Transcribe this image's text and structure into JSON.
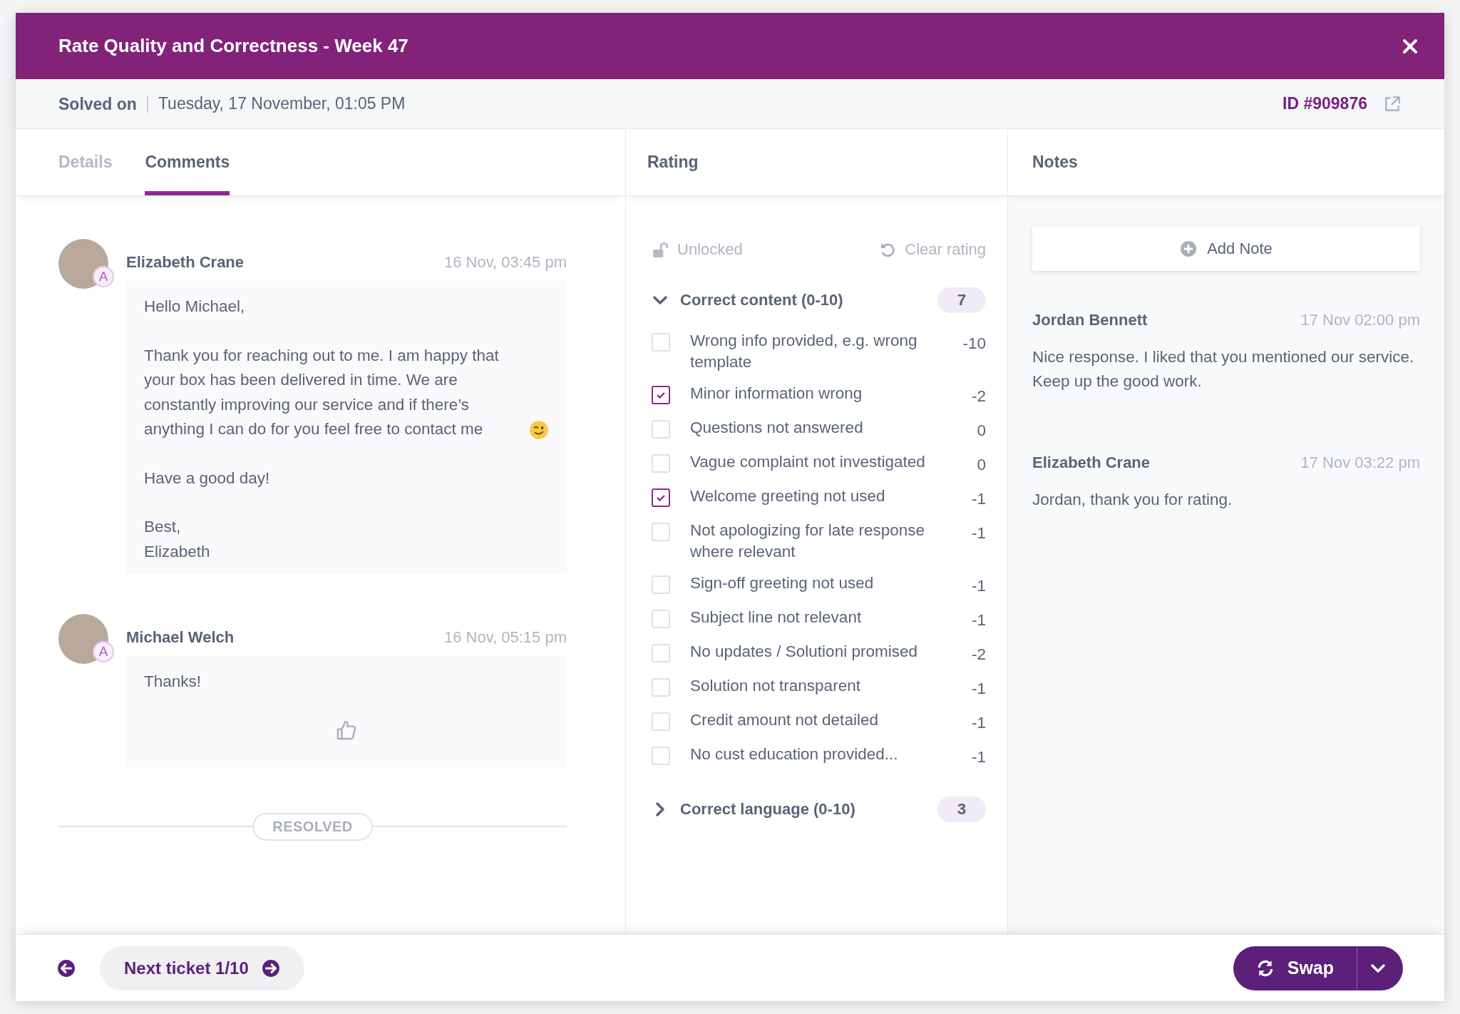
{
  "window": {
    "title": "Rate Quality and Correctness - Week 47"
  },
  "solved": {
    "label": "Solved on",
    "date": "Tuesday, 17 November, 01:05 PM",
    "ticket_id": "ID #909876"
  },
  "tabs": [
    {
      "label": "Details",
      "selected": false
    },
    {
      "label": "Comments",
      "selected": true
    }
  ],
  "comments": [
    {
      "author": "Elizabeth Crane",
      "badge": "A",
      "time": "16 Nov, 03:45 pm",
      "paragraphs": [
        {
          "text": "Hello Michael,"
        },
        {
          "text": "Thank you for reaching out to me. I am happy that your box has been delivered in time. We are constantly improving our service and if there’s anything I can do for you feel free to contact me",
          "winking_emoji": true
        },
        {
          "text": "Have a good day!"
        },
        {
          "text": "Best,\nElizabeth"
        }
      ]
    },
    {
      "author": "Michael Welch",
      "badge": "A",
      "time": "16 Nov, 05:15 pm",
      "paragraphs": [
        {
          "text": "Thanks!"
        }
      ],
      "thumbs_up": true
    }
  ],
  "resolved_label": "RESOLVED",
  "rating": {
    "title": "Rating",
    "lock": "Unlocked",
    "clear": "Clear rating",
    "groups": [
      {
        "title": "Correct content (0-10)",
        "score": "7",
        "expanded": true,
        "items": [
          {
            "label": "Wrong info provided, e.g. wrong template",
            "points": "-10",
            "checked": false
          },
          {
            "label": "Minor information wrong",
            "points": "-2",
            "checked": true
          },
          {
            "label": "Questions not answered",
            "points": "0",
            "checked": false
          },
          {
            "label": "Vague complaint not investigated",
            "points": "0",
            "checked": false
          },
          {
            "label": "Welcome greeting not used",
            "points": "-1",
            "checked": true
          },
          {
            "label": "Not apologizing for late response where relevant",
            "points": "-1",
            "checked": false
          },
          {
            "label": "Sign-off greeting not used",
            "points": "-1",
            "checked": false
          },
          {
            "label": "Subject line not relevant",
            "points": "-1",
            "checked": false
          },
          {
            "label": "No updates / Solutioni promised",
            "points": "-2",
            "checked": false
          },
          {
            "label": "Solution not transparent",
            "points": "-1",
            "checked": false
          },
          {
            "label": "Credit amount not detailed",
            "points": "-1",
            "checked": false
          },
          {
            "label": "No cust education provided...",
            "points": "-1",
            "checked": false
          }
        ]
      },
      {
        "title": "Correct language (0-10)",
        "score": "3",
        "expanded": false
      }
    ]
  },
  "notes": {
    "title": "Notes",
    "add_button": "Add Note",
    "items": [
      {
        "author": "Jordan Bennett",
        "time": "17 Nov 02:00 pm",
        "text": "Nice response. I liked that you mentioned our service. Keep up the good work."
      },
      {
        "author": "Elizabeth Crane",
        "time": "17 Nov 03:22 pm",
        "text": "Jordan, thank you for rating."
      }
    ]
  },
  "footer": {
    "next_button": "Next ticket 1/10",
    "swap_button": "Swap"
  }
}
